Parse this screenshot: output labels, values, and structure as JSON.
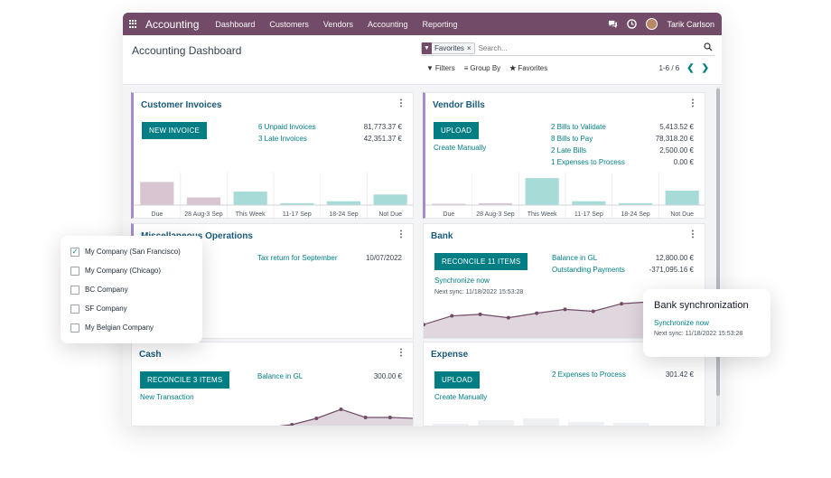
{
  "topnav": {
    "app_name": "Accounting",
    "menu": [
      "Dashboard",
      "Customers",
      "Vendors",
      "Accounting",
      "Reporting"
    ],
    "user": "Tarik Carlson"
  },
  "control": {
    "title": "Accounting Dashboard",
    "facet": "Favorites",
    "facet_remove": "×",
    "search_placeholder": "Search...",
    "filters": "Filters",
    "group_by": "Group By",
    "favorites": "Favorites",
    "pager": "1-6 / 6",
    "prev": "❮",
    "next": "❯"
  },
  "customer_invoices": {
    "title": "Customer Invoices",
    "button": "NEW INVOICE",
    "rows": [
      {
        "label": "6 Unpaid Invoices",
        "value": "81,773.37 €"
      },
      {
        "label": "3 Late Invoices",
        "value": "42,351.37 €"
      }
    ],
    "ticks": [
      "Due",
      "28 Aug-3 Sep",
      "This Week",
      "11-17 Sep",
      "18-24 Sep",
      "Not Due"
    ]
  },
  "vendor_bills": {
    "title": "Vendor Bills",
    "button": "UPLOAD",
    "create_link": "Create Manually",
    "rows": [
      {
        "label": "2 Bills to Validate",
        "value": "5,413.52 €"
      },
      {
        "label": "8 Bills to Pay",
        "value": "78,318.20 €"
      },
      {
        "label": "2 Late Bills",
        "value": "2,500.00 €"
      },
      {
        "label": "1 Expenses to Process",
        "value": "0.00 €"
      }
    ],
    "ticks": [
      "Due",
      "28 Aug-3 Sep",
      "This Week",
      "11-17 Sep",
      "18-24 Sep",
      "Not Due"
    ]
  },
  "misc": {
    "title": "Miscellaneous Operations",
    "link": "Tax return for September",
    "date": "10/07/2022"
  },
  "bank": {
    "title": "Bank",
    "button": "RECONCILE 11 ITEMS",
    "sync_link": "Synchronize now",
    "next_sync": "Next sync: 11/18/2022 15:53:28",
    "rows": [
      {
        "label": "Balance in GL",
        "value": "12,800.00 €"
      },
      {
        "label": "Outstanding Payments",
        "value": "-371,095.16 €"
      }
    ]
  },
  "cash": {
    "title": "Cash",
    "button": "RECONCILE 3 ITEMS",
    "link": "New Transaction",
    "balance_label": "Balance in GL",
    "balance_value": "300.00 €"
  },
  "expense": {
    "title": "Expense",
    "button": "UPLOAD",
    "create_link": "Create Manually",
    "link": "2 Expenses to Process",
    "value": "301.42 €"
  },
  "companies": [
    {
      "name": "My Company (San Francisco)",
      "checked": true
    },
    {
      "name": "My Company (Chicago)",
      "checked": false
    },
    {
      "name": "BC Company",
      "checked": false
    },
    {
      "name": "SF Company",
      "checked": false
    },
    {
      "name": "My Belgian Company",
      "checked": false
    }
  ],
  "sync_popup": {
    "title": "Bank synchronization",
    "link": "Synchronize now",
    "next": "Next sync: 11/18/2022 15:53:28"
  },
  "chart_data": [
    {
      "type": "bar",
      "categories": [
        "Due",
        "28 Aug-3 Sep",
        "This Week",
        "11-17 Sep",
        "18-24 Sep",
        "Not Due"
      ],
      "values": [
        24,
        8,
        14,
        2,
        4,
        11
      ],
      "colors": [
        "#d9c5d1",
        "#d9c5d1",
        "#a7dbd7",
        "#a7dbd7",
        "#a7dbd7",
        "#a7dbd7"
      ]
    },
    {
      "type": "bar",
      "categories": [
        "Due",
        "28 Aug-3 Sep",
        "This Week",
        "11-17 Sep",
        "18-24 Sep",
        "Not Due"
      ],
      "values": [
        0,
        2,
        28,
        4,
        2,
        15
      ],
      "colors": [
        "#d9c5d1",
        "#d9c5d1",
        "#a7dbd7",
        "#a7dbd7",
        "#a7dbd7",
        "#a7dbd7"
      ]
    },
    {
      "type": "area",
      "values": [
        0.4,
        0.63,
        0.67,
        0.58,
        0.7,
        0.8,
        0.75,
        0.95,
        1.0,
        1.0,
        1.0
      ],
      "color": "#714b67"
    },
    {
      "type": "area",
      "values": [
        0.0,
        0.15,
        0.5,
        1.0,
        0.55,
        0.55,
        0.5
      ],
      "color": "#714b67"
    }
  ]
}
